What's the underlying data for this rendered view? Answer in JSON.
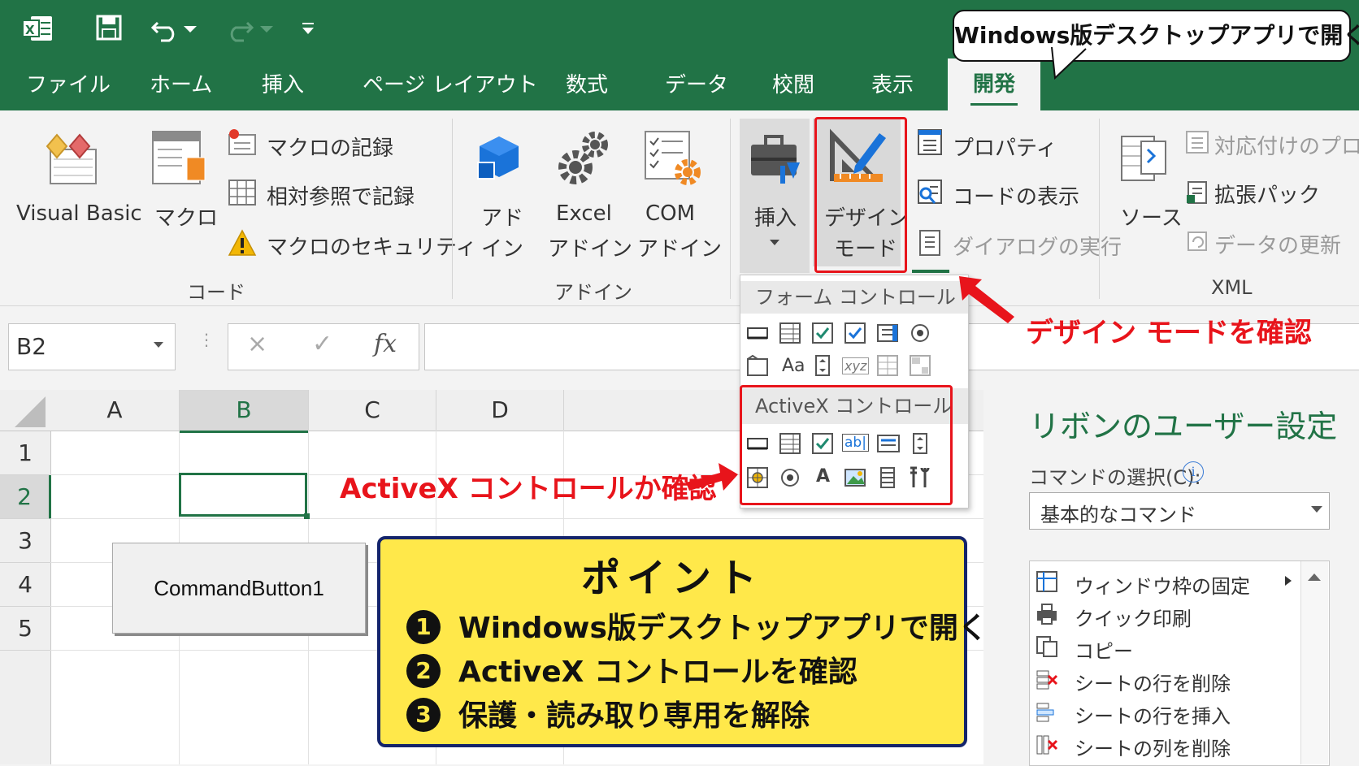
{
  "app": {
    "colors": {
      "accent": "#217346",
      "annotation_red": "#e8141b",
      "point_bg": "#ffe84a",
      "point_border": "#14246b"
    }
  },
  "tabs": [
    {
      "label": "ファイル"
    },
    {
      "label": "ホーム"
    },
    {
      "label": "挿入"
    },
    {
      "label": "ページ レイアウト"
    },
    {
      "label": "数式"
    },
    {
      "label": "データ"
    },
    {
      "label": "校閲"
    },
    {
      "label": "表示"
    },
    {
      "label": "開発"
    }
  ],
  "callout": "Windows版デスクトップアプリで開く",
  "ribbon": {
    "code": {
      "visual_basic": "Visual Basic",
      "macro": "マクロ",
      "record_macro": "マクロの記録",
      "relative_record": "相対参照で記録",
      "macro_security": "マクロのセキュリティ",
      "group_label": "コード"
    },
    "addin": {
      "addin_l1": "アド",
      "addin_l2": "イン",
      "excel_l1": "Excel",
      "excel_l2": "アドイン",
      "com_l1": "COM",
      "com_l2": "アドイン",
      "group_label": "アドイン"
    },
    "controls": {
      "insert": "挿入",
      "design_l1": "デザイン",
      "design_l2": "モード",
      "properties": "プロパティ",
      "view_code": "コードの表示",
      "run_dialog": "ダイアログの実行"
    },
    "xml": {
      "source": "ソース",
      "map_properties": "対応付けのプロパティ",
      "expansion_packs": "拡張パック",
      "refresh_data": "データの更新",
      "group_label": "XML"
    }
  },
  "dropdown": {
    "form_header": "フォーム コントロール",
    "activex_header": "ActiveX コントロール"
  },
  "annotations": {
    "design_mode": "デザイン モードを確認",
    "activex": "ActiveX コントロールか確認"
  },
  "formula_bar": {
    "name_box": "B2",
    "cancel": "×",
    "enter": "✓",
    "fx": "fx"
  },
  "sheet": {
    "columns": [
      "A",
      "B",
      "C",
      "D"
    ],
    "rows": [
      "1",
      "2",
      "3",
      "4",
      "5"
    ],
    "command_button": "CommandButton1"
  },
  "point": {
    "title": "ポイント",
    "items": [
      {
        "num": "1",
        "text": "Windows版デスクトップアプリで開く"
      },
      {
        "num": "2",
        "text": "ActiveX コントロールを確認"
      },
      {
        "num": "3",
        "text": "保護・読み取り専用を解除"
      }
    ]
  },
  "right_panel": {
    "title": "リボンのユーザー設定",
    "command_label": "コマンドの選択(C):",
    "select_value": "基本的なコマンド",
    "list": [
      {
        "label": "ウィンドウ枠の固定"
      },
      {
        "label": "クイック印刷"
      },
      {
        "label": "コピー"
      },
      {
        "label": "シートの行を削除"
      },
      {
        "label": "シートの行を挿入"
      },
      {
        "label": "シートの列を削除"
      }
    ]
  }
}
